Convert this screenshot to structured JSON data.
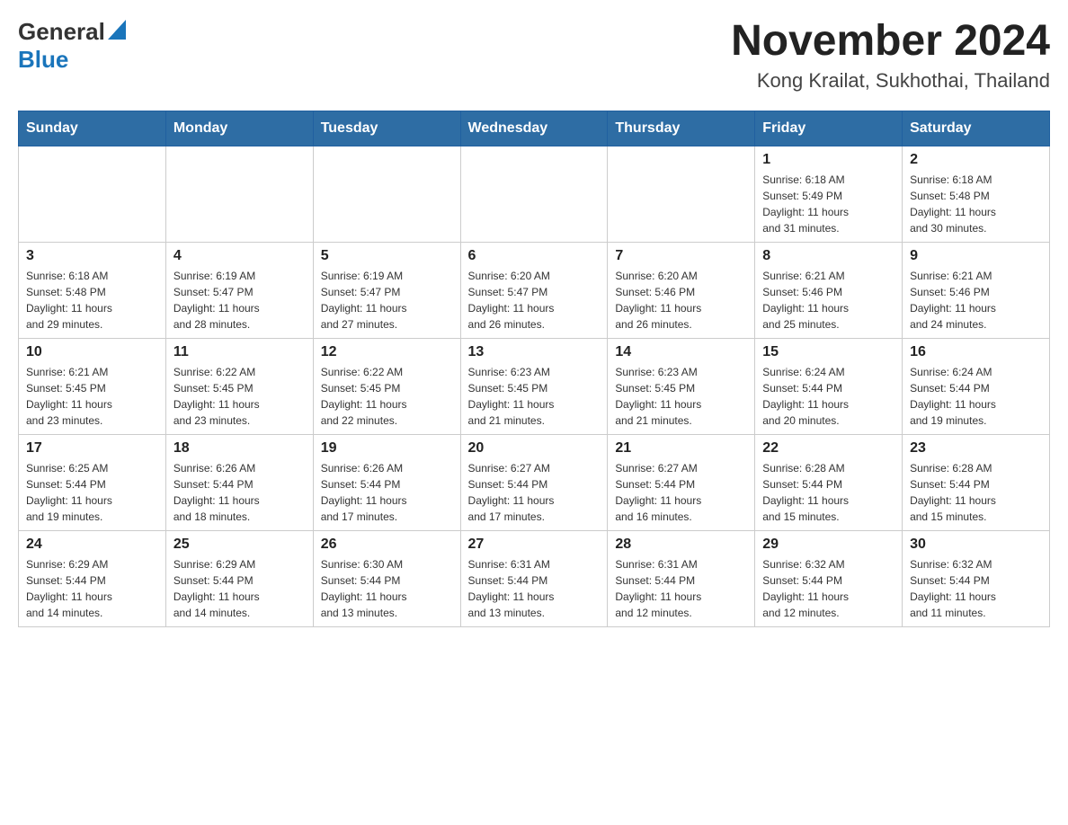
{
  "header": {
    "logo_general": "General",
    "logo_blue": "Blue",
    "title": "November 2024",
    "subtitle": "Kong Krailat, Sukhothai, Thailand"
  },
  "weekdays": [
    "Sunday",
    "Monday",
    "Tuesday",
    "Wednesday",
    "Thursday",
    "Friday",
    "Saturday"
  ],
  "weeks": [
    {
      "days": [
        {
          "number": "",
          "info": ""
        },
        {
          "number": "",
          "info": ""
        },
        {
          "number": "",
          "info": ""
        },
        {
          "number": "",
          "info": ""
        },
        {
          "number": "",
          "info": ""
        },
        {
          "number": "1",
          "info": "Sunrise: 6:18 AM\nSunset: 5:49 PM\nDaylight: 11 hours\nand 31 minutes."
        },
        {
          "number": "2",
          "info": "Sunrise: 6:18 AM\nSunset: 5:48 PM\nDaylight: 11 hours\nand 30 minutes."
        }
      ]
    },
    {
      "days": [
        {
          "number": "3",
          "info": "Sunrise: 6:18 AM\nSunset: 5:48 PM\nDaylight: 11 hours\nand 29 minutes."
        },
        {
          "number": "4",
          "info": "Sunrise: 6:19 AM\nSunset: 5:47 PM\nDaylight: 11 hours\nand 28 minutes."
        },
        {
          "number": "5",
          "info": "Sunrise: 6:19 AM\nSunset: 5:47 PM\nDaylight: 11 hours\nand 27 minutes."
        },
        {
          "number": "6",
          "info": "Sunrise: 6:20 AM\nSunset: 5:47 PM\nDaylight: 11 hours\nand 26 minutes."
        },
        {
          "number": "7",
          "info": "Sunrise: 6:20 AM\nSunset: 5:46 PM\nDaylight: 11 hours\nand 26 minutes."
        },
        {
          "number": "8",
          "info": "Sunrise: 6:21 AM\nSunset: 5:46 PM\nDaylight: 11 hours\nand 25 minutes."
        },
        {
          "number": "9",
          "info": "Sunrise: 6:21 AM\nSunset: 5:46 PM\nDaylight: 11 hours\nand 24 minutes."
        }
      ]
    },
    {
      "days": [
        {
          "number": "10",
          "info": "Sunrise: 6:21 AM\nSunset: 5:45 PM\nDaylight: 11 hours\nand 23 minutes."
        },
        {
          "number": "11",
          "info": "Sunrise: 6:22 AM\nSunset: 5:45 PM\nDaylight: 11 hours\nand 23 minutes."
        },
        {
          "number": "12",
          "info": "Sunrise: 6:22 AM\nSunset: 5:45 PM\nDaylight: 11 hours\nand 22 minutes."
        },
        {
          "number": "13",
          "info": "Sunrise: 6:23 AM\nSunset: 5:45 PM\nDaylight: 11 hours\nand 21 minutes."
        },
        {
          "number": "14",
          "info": "Sunrise: 6:23 AM\nSunset: 5:45 PM\nDaylight: 11 hours\nand 21 minutes."
        },
        {
          "number": "15",
          "info": "Sunrise: 6:24 AM\nSunset: 5:44 PM\nDaylight: 11 hours\nand 20 minutes."
        },
        {
          "number": "16",
          "info": "Sunrise: 6:24 AM\nSunset: 5:44 PM\nDaylight: 11 hours\nand 19 minutes."
        }
      ]
    },
    {
      "days": [
        {
          "number": "17",
          "info": "Sunrise: 6:25 AM\nSunset: 5:44 PM\nDaylight: 11 hours\nand 19 minutes."
        },
        {
          "number": "18",
          "info": "Sunrise: 6:26 AM\nSunset: 5:44 PM\nDaylight: 11 hours\nand 18 minutes."
        },
        {
          "number": "19",
          "info": "Sunrise: 6:26 AM\nSunset: 5:44 PM\nDaylight: 11 hours\nand 17 minutes."
        },
        {
          "number": "20",
          "info": "Sunrise: 6:27 AM\nSunset: 5:44 PM\nDaylight: 11 hours\nand 17 minutes."
        },
        {
          "number": "21",
          "info": "Sunrise: 6:27 AM\nSunset: 5:44 PM\nDaylight: 11 hours\nand 16 minutes."
        },
        {
          "number": "22",
          "info": "Sunrise: 6:28 AM\nSunset: 5:44 PM\nDaylight: 11 hours\nand 15 minutes."
        },
        {
          "number": "23",
          "info": "Sunrise: 6:28 AM\nSunset: 5:44 PM\nDaylight: 11 hours\nand 15 minutes."
        }
      ]
    },
    {
      "days": [
        {
          "number": "24",
          "info": "Sunrise: 6:29 AM\nSunset: 5:44 PM\nDaylight: 11 hours\nand 14 minutes."
        },
        {
          "number": "25",
          "info": "Sunrise: 6:29 AM\nSunset: 5:44 PM\nDaylight: 11 hours\nand 14 minutes."
        },
        {
          "number": "26",
          "info": "Sunrise: 6:30 AM\nSunset: 5:44 PM\nDaylight: 11 hours\nand 13 minutes."
        },
        {
          "number": "27",
          "info": "Sunrise: 6:31 AM\nSunset: 5:44 PM\nDaylight: 11 hours\nand 13 minutes."
        },
        {
          "number": "28",
          "info": "Sunrise: 6:31 AM\nSunset: 5:44 PM\nDaylight: 11 hours\nand 12 minutes."
        },
        {
          "number": "29",
          "info": "Sunrise: 6:32 AM\nSunset: 5:44 PM\nDaylight: 11 hours\nand 12 minutes."
        },
        {
          "number": "30",
          "info": "Sunrise: 6:32 AM\nSunset: 5:44 PM\nDaylight: 11 hours\nand 11 minutes."
        }
      ]
    }
  ]
}
